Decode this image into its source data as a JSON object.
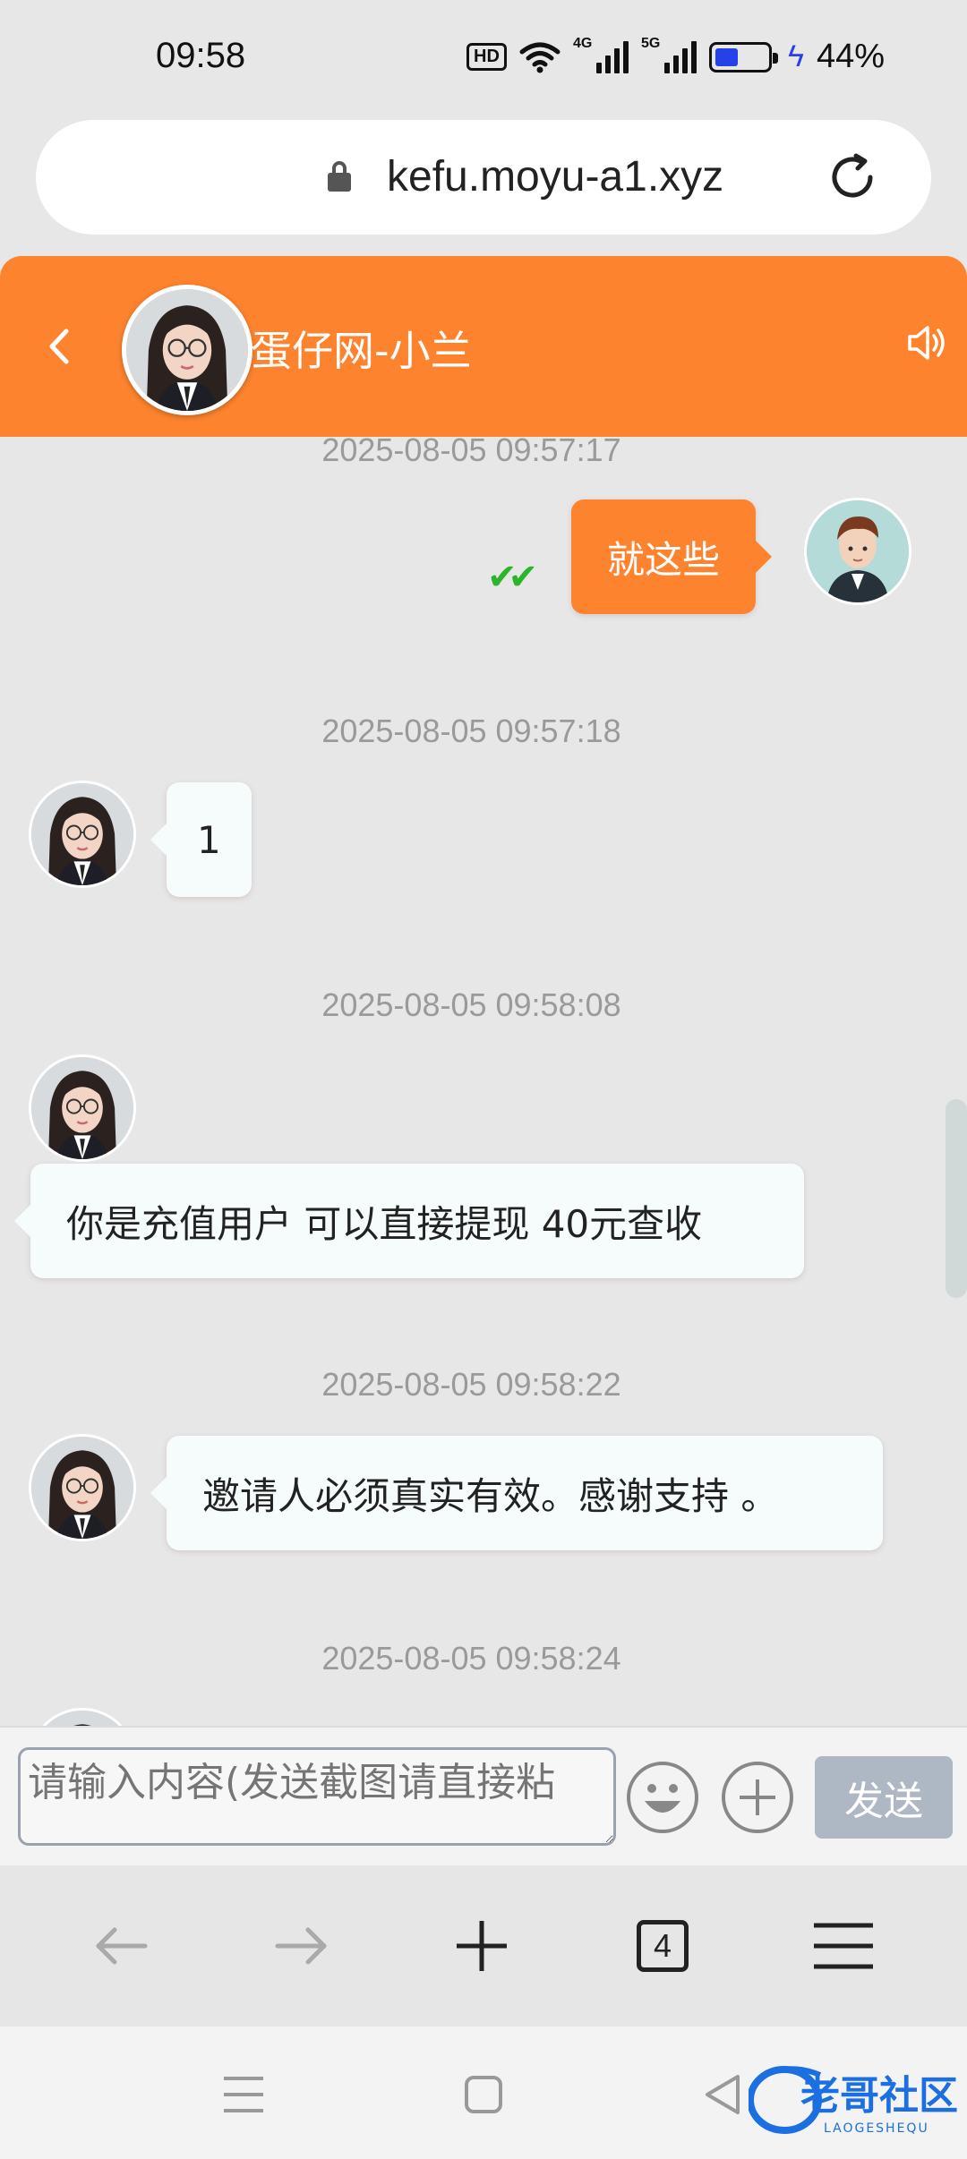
{
  "status_bar": {
    "time": "09:58",
    "hd_label": "HD",
    "net1": "4G",
    "net2": "5G",
    "battery_percent_text": "44%",
    "battery_level": 0.44
  },
  "browser": {
    "url": "kefu.moyu-a1.xyz",
    "tab_count": "4"
  },
  "chat": {
    "title": "蛋仔网-小兰",
    "messages": [
      {
        "timestamp": "2025-08-05 09:57:17",
        "sender": "me",
        "text": "就这些"
      },
      {
        "timestamp": "2025-08-05 09:57:18",
        "sender": "agent",
        "text": "1"
      },
      {
        "timestamp": "2025-08-05 09:58:08",
        "sender": "agent",
        "text": "你是充值用户 可以直接提现 40元查收"
      },
      {
        "timestamp": "2025-08-05 09:58:22",
        "sender": "agent",
        "text": "邀请人必须真实有效。感谢支持 。"
      },
      {
        "timestamp": "2025-08-05 09:58:24",
        "sender": "agent",
        "text": ""
      }
    ],
    "read_ticks": "✔✔"
  },
  "input": {
    "placeholder": "请输入内容(发送截图请直接粘",
    "send_label": "发送"
  },
  "watermark": {
    "text": "老哥社区",
    "subtext": "LAOGESHEQU"
  },
  "colors": {
    "accent": "#fd832e",
    "bubble": "#f5fcfb",
    "send_disabled": "#adb8c4",
    "battery": "#2741e8",
    "ticks": "#2bb52b"
  }
}
